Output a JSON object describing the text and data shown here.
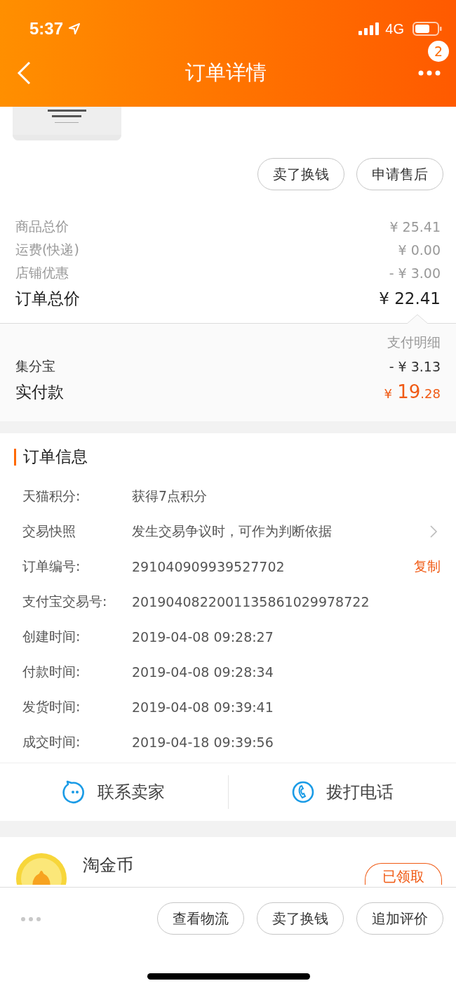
{
  "status_bar": {
    "time": "5:37",
    "network": "4G"
  },
  "nav": {
    "title": "订单详情",
    "badge": "2"
  },
  "product": {
    "kind": "picture"
  },
  "product_actions": [
    "卖了换钱",
    "申请售后"
  ],
  "price_rows": [
    {
      "label": "商品总价",
      "value": "¥ 25.41",
      "kind": "minor"
    },
    {
      "label": "运费(快递)",
      "value": "¥ 0.00",
      "kind": "minor"
    },
    {
      "label": "店铺优惠",
      "value": "- ¥ 3.00",
      "kind": "minor"
    },
    {
      "label": "订单总价",
      "value": "¥ 22.41",
      "kind": "total"
    }
  ],
  "payment": {
    "title": "支付明细",
    "rows": [
      {
        "label": "集分宝",
        "value": "- ¥ 3.13"
      }
    ],
    "paid_label": "实付款",
    "paid_currency": "¥",
    "paid_integer": "19",
    "paid_decimal": ".28"
  },
  "order_info": {
    "title": "订单信息",
    "rows": [
      {
        "label": "天猫积分:",
        "value": "获得7点积分"
      },
      {
        "label": "交易快照",
        "value": "发生交易争议时，可作为判断依据",
        "kind": "link"
      },
      {
        "label": "订单编号:",
        "value": "291040909939527702",
        "action": "复制"
      },
      {
        "label": "支付宝交易号:",
        "value": "2019040822001135861029978722"
      },
      {
        "label": "创建时间:",
        "value": "2019-04-08 09:28:27"
      },
      {
        "label": "付款时间:",
        "value": "2019-04-08 09:28:34"
      },
      {
        "label": "发货时间:",
        "value": "2019-04-08 09:39:41"
      },
      {
        "label": "成交时间:",
        "value": "2019-04-18 09:39:56"
      }
    ]
  },
  "contact": [
    {
      "label": "联系卖家",
      "kind": "chat"
    },
    {
      "label": "拨打电话",
      "kind": "phone"
    }
  ],
  "coins": {
    "title": "淘金币",
    "button": "已领取"
  },
  "bottom_actions": [
    "查看物流",
    "卖了换钱",
    "追加评价"
  ]
}
